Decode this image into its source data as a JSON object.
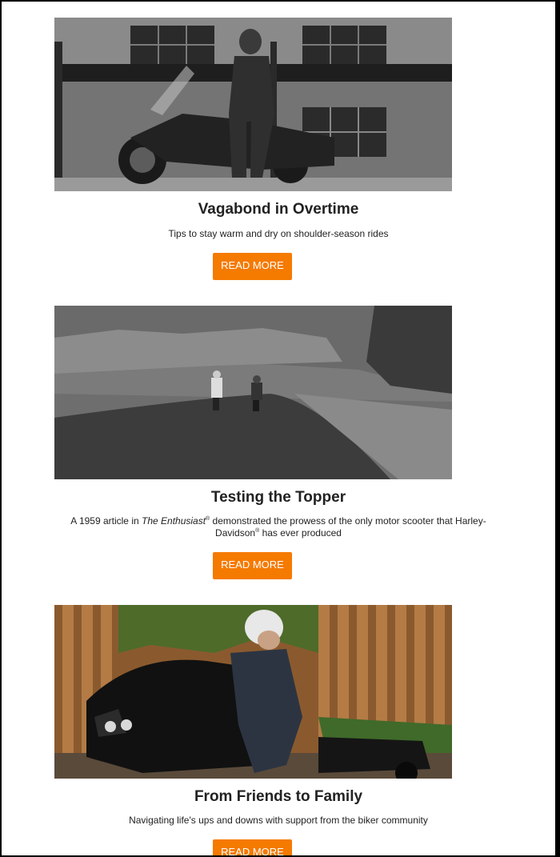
{
  "articles": [
    {
      "title": "Vagabond in Overtime",
      "description": "Tips to stay warm and dry on shoulder-season rides",
      "button_label": "READ MORE",
      "image": "rider-leaning-on-motorcycle-photo"
    },
    {
      "title": "Testing the Topper",
      "description": {
        "pre": "A 1959 article in ",
        "em": "The Enthusiast",
        "reg1": "®",
        "mid": " demonstrated the prowess of the only motor scooter that Harley-Davidson",
        "reg2": "®",
        "post": " has ever produced"
      },
      "button_label": "READ MORE",
      "image": "scooters-on-desert-road-photo"
    },
    {
      "title": "From Friends to Family",
      "description": "Navigating life's ups and downs with support from the biker community",
      "button_label": "READ MORE",
      "image": "rider-on-touring-bike-photo"
    }
  ],
  "colors": {
    "button": "#f57a00",
    "button_text": "#ffffff",
    "frame": "#000000"
  }
}
